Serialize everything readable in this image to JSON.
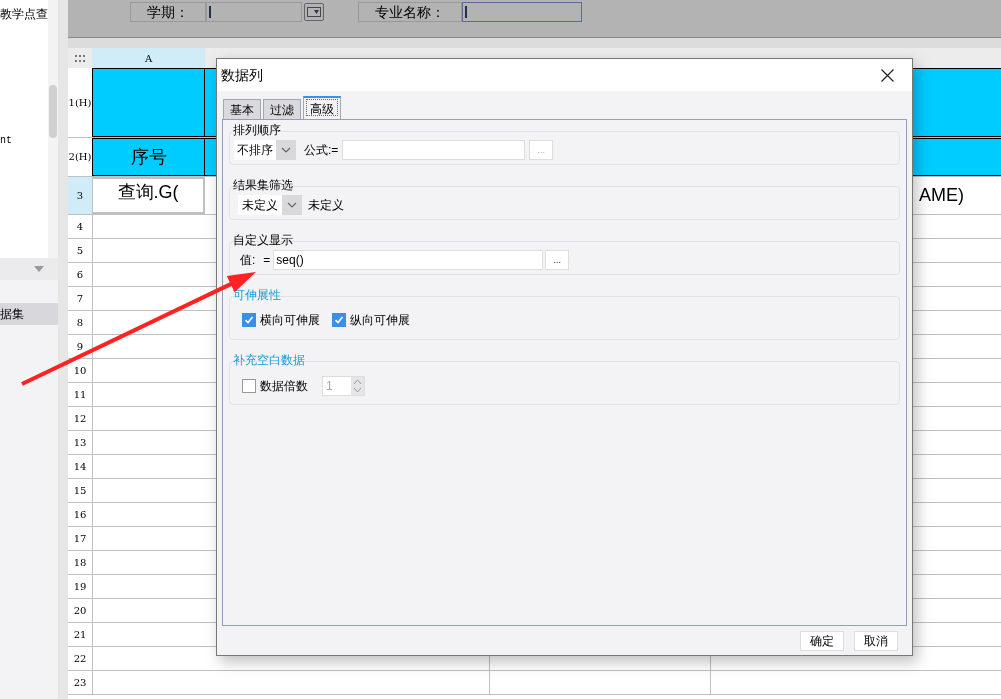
{
  "sidebar": {
    "texts": [
      "教学点查",
      "nt"
    ],
    "dataset_item": {
      "label": "据集",
      "selected": true
    }
  },
  "query_form": {
    "fields": [
      {
        "label": "学期：",
        "kind": "dropdown"
      },
      {
        "label": "专业名称：",
        "kind": "text"
      }
    ]
  },
  "sheet": {
    "columns": [
      {
        "label": "A"
      }
    ],
    "rows": [
      {
        "label": "1(H)",
        "kind": "header"
      },
      {
        "label": "2(H)",
        "kind": "header",
        "cell_a": {
          "text": "序号",
          "selected": false
        }
      },
      {
        "label": "3",
        "kind": "data",
        "cell_a": {
          "text": "查询.G(",
          "selected": true
        },
        "cell_d": {
          "text": "AME)"
        }
      },
      {
        "label": "4",
        "kind": "data"
      },
      {
        "label": "5",
        "kind": "data"
      },
      {
        "label": "6",
        "kind": "data"
      },
      {
        "label": "7",
        "kind": "data"
      },
      {
        "label": "8",
        "kind": "data"
      },
      {
        "label": "9",
        "kind": "data"
      },
      {
        "label": "10",
        "kind": "data"
      },
      {
        "label": "11",
        "kind": "data"
      },
      {
        "label": "12",
        "kind": "data"
      },
      {
        "label": "13",
        "kind": "data"
      },
      {
        "label": "14",
        "kind": "data"
      },
      {
        "label": "15",
        "kind": "data"
      },
      {
        "label": "16",
        "kind": "data"
      },
      {
        "label": "17",
        "kind": "data"
      },
      {
        "label": "18",
        "kind": "data"
      },
      {
        "label": "19",
        "kind": "data"
      },
      {
        "label": "20",
        "kind": "data"
      },
      {
        "label": "21",
        "kind": "data"
      },
      {
        "label": "22",
        "kind": "data"
      },
      {
        "label": "23",
        "kind": "data"
      }
    ]
  },
  "dialog": {
    "title": "数据列",
    "tabs": [
      {
        "label": "基本",
        "selected": false
      },
      {
        "label": "过滤",
        "selected": false
      },
      {
        "label": "高级",
        "selected": true
      }
    ],
    "groups": [
      {
        "kind": "sort",
        "title": "排列顺序",
        "select": "不排序",
        "formula_label": "公式:=",
        "more": "..."
      },
      {
        "kind": "filter",
        "title": "结果集筛选",
        "select": "未定义",
        "value": "未定义"
      },
      {
        "kind": "display",
        "title": "自定义显示",
        "label": "值:",
        "equals": "=",
        "value": "seq()",
        "more": "..."
      },
      {
        "kind": "checks",
        "title": "可伸展性",
        "checks": [
          {
            "label": "横向可伸展",
            "checked": true
          },
          {
            "label": "纵向可伸展",
            "checked": true
          }
        ]
      },
      {
        "kind": "multiple",
        "title": "补充空白数据",
        "check": {
          "label": "数据倍数",
          "checked": false
        },
        "spinner": "1"
      }
    ],
    "buttons": [
      "确定",
      "取消"
    ]
  }
}
